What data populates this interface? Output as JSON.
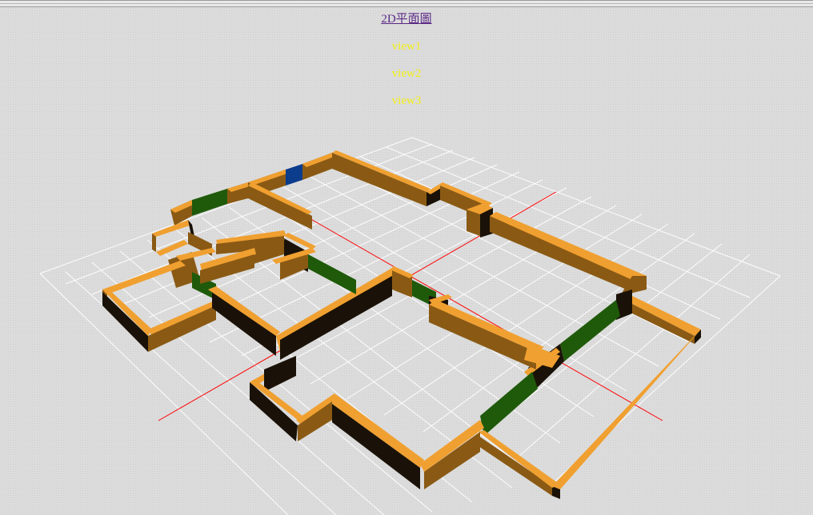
{
  "nav": {
    "plan_link": "2D平面圖",
    "views": [
      "view1",
      "view2",
      "view3"
    ]
  },
  "colors": {
    "wall_top": "#f0a030",
    "wall_side": "#8a5a14",
    "wall_shadow": "#1a1208",
    "window": "#1f5a0a",
    "door": "#0c3c8c",
    "grid": "#ffffff",
    "axis": "#ff0000",
    "background": "#dcdcdc"
  },
  "viewport": {
    "name": "3d-floorplan-viewer"
  }
}
